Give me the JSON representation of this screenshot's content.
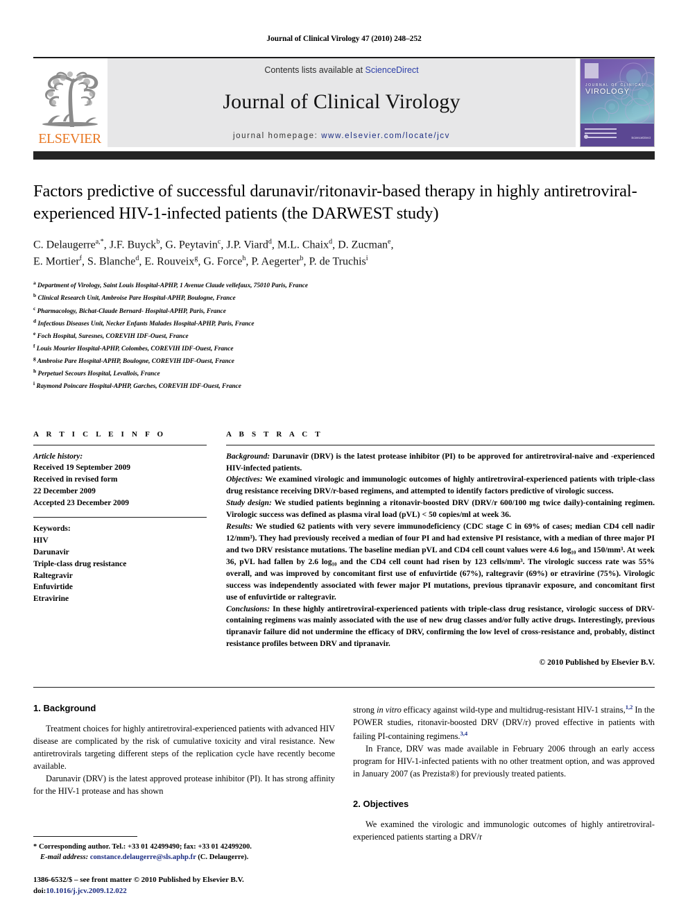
{
  "running_head": "Journal of Clinical Virology 47 (2010) 248–252",
  "masthead": {
    "publisher_name": "ELSEVIER",
    "contents_prefix": "Contents lists available at",
    "contents_link": "ScienceDirect",
    "journal_name": "Journal of Clinical Virology",
    "homepage_prefix": "journal homepage:",
    "homepage_url": "www.elsevier.com/locate/jcv",
    "cover": {
      "sub_title": "JOURNAL OF CLINICAL",
      "title": "VIROLOGY",
      "footer_brand": "ScienceDirect"
    },
    "colors": {
      "link_blue": "#2b3ea8",
      "url_navy": "#1c2d82",
      "elsevier_orange": "#E87722",
      "band_dark": "#232323",
      "masthead_grey": "#e7e7e8"
    }
  },
  "article": {
    "title": "Factors predictive of successful darunavir/ritonavir-based therapy in highly antiretroviral-experienced HIV-1-infected patients (the DARWEST study)",
    "authors_line_1": "C. Delaugerre<sup>a,*</sup>, J.F. Buyck<sup>b</sup>, G. Peytavin<sup>c</sup>, J.P. Viard<sup>d</sup>, M.L. Chaix<sup>d</sup>, D. Zucman<sup>e</sup>,",
    "authors_line_2": "E. Mortier<sup>f</sup>, S. Blanche<sup>d</sup>, E. Rouveix<sup>g</sup>, G. Force<sup>h</sup>, P. Aegerter<sup>b</sup>, P. de Truchis<sup>i</sup>",
    "affiliations": [
      {
        "mark": "a",
        "text": "Department of Virology, Saint Louis Hospital-APHP, 1 Avenue Claude vellefaux, 75010 Paris, France"
      },
      {
        "mark": "b",
        "text": "Clinical Research Unit, Ambroise Pare Hospital-APHP, Boulogne, France"
      },
      {
        "mark": "c",
        "text": "Pharmacology, Bichat-Claude Bernard- Hospital-APHP, Paris, France"
      },
      {
        "mark": "d",
        "text": "Infectious Diseases Unit, Necker Enfants Malades Hospital-APHP, Paris, France"
      },
      {
        "mark": "e",
        "text": "Foch Hospital, Suresnes, COREVIH IDF-Ouest, France"
      },
      {
        "mark": "f",
        "text": "Louis Mourier Hospital-APHP, Colombes, COREVIH IDF-Ouest, France"
      },
      {
        "mark": "g",
        "text": "Ambroise Pare Hospital-APHP, Boulogne, COREVIH IDF-Ouest, France"
      },
      {
        "mark": "h",
        "text": "Perpetuel Secours Hospital, Levallois, France"
      },
      {
        "mark": "i",
        "text": "Raymond Poincare Hospital-APHP, Garches, COREVIH IDF-Ouest, France"
      }
    ]
  },
  "article_info": {
    "heading": "A R T I C L E  I N F O",
    "history_label": "Article history:",
    "history": [
      "Received 19 September 2009",
      "Received in revised form",
      "22 December 2009",
      "Accepted 23 December 2009"
    ],
    "keywords_label": "Keywords:",
    "keywords": [
      "HIV",
      "Darunavir",
      "Triple-class drug resistance",
      "Raltegravir",
      "Enfuvirtide",
      "Etravirine"
    ]
  },
  "abstract": {
    "heading": "A B S T R A C T",
    "sections": [
      {
        "label": "Background:",
        "text": " Darunavir (DRV) is the latest protease inhibitor (PI) to be approved for antiretroviral-naive and -experienced HIV-infected patients."
      },
      {
        "label": "Objectives:",
        "text": " We examined virologic and immunologic outcomes of highly antiretroviral-experienced patients with triple-class drug resistance receiving DRV/r-based regimens, and attempted to identify factors predictive of virologic success."
      },
      {
        "label": "Study design:",
        "text": " We studied patients beginning a ritonavir-boosted DRV (DRV/r 600/100 mg twice daily)-containing regimen. Virologic success was defined as plasma viral load (pVL) < 50 copies/ml at week 36."
      },
      {
        "label": "Results:",
        "text": " We studied 62 patients with very severe immunodeficiency (CDC stage C in 69% of cases; median CD4 cell nadir 12/mm³). They had previously received a median of four PI and had extensive PI resistance, with a median of three major PI and two DRV resistance mutations. The baseline median pVL and CD4 cell count values were 4.6 log₁₀ and 150/mm³. At week 36, pVL had fallen by 2.6 log₁₀ and the CD4 cell count had risen by 123 cells/mm³. The virologic success rate was 55% overall, and was improved by concomitant first use of enfuvirtide (67%), raltegravir (69%) or etravirine (75%). Virologic success was independently associated with fewer major PI mutations, previous tipranavir exposure, and concomitant first use of enfuvirtide or raltegravir."
      },
      {
        "label": "Conclusions:",
        "text": " In these highly antiretroviral-experienced patients with triple-class drug resistance, virologic success of DRV-containing regimens was mainly associated with the use of new drug classes and/or fully active drugs. Interestingly, previous tipranavir failure did not undermine the efficacy of DRV, confirming the low level of cross-resistance and, probably, distinct resistance profiles between DRV and tipranavir."
      }
    ],
    "copyright": "© 2010 Published by Elsevier B.V."
  },
  "body": {
    "left": {
      "section1_heading": "1.  Background",
      "p1": "Treatment choices for highly antiretroviral-experienced patients with advanced HIV disease are complicated by the risk of cumulative toxicity and viral resistance. New antiretrovirals targeting different steps of the replication cycle have recently become available.",
      "p2": "Darunavir (DRV) is the latest approved protease inhibitor (PI). It has strong affinity for the HIV-1 protease and has shown"
    },
    "right": {
      "p1_pre": "strong ",
      "p1_italic": "in vitro",
      "p1_mid": " efficacy against wild-type and multidrug-resistant HIV-1 strains,",
      "p1_ref1": "1,2",
      "p1_mid2": " In the POWER studies, ritonavir-boosted DRV (DRV/r) proved effective in patients with failing PI-containing regimens.",
      "p1_ref2": "3,4",
      "p2": "In France, DRV was made available in February 2006 through an early access program for HIV-1-infected patients with no other treatment option, and was approved in January 2007 (as Prezista®) for previously treated patients.",
      "section2_heading": "2.  Objectives",
      "p3": "We examined the virologic and immunologic outcomes of highly antiretroviral-experienced patients starting a DRV/r"
    }
  },
  "footnote": {
    "corresponding": "* Corresponding author. Tel.: +33 01 42499490; fax: +33 01 42499200.",
    "email_label": "E-mail address:",
    "email": "constance.delaugerre@sls.aphp.fr",
    "email_suffix": " (C. Delaugerre).",
    "issn_line": "1386-6532/$ – see front matter © 2010 Published by Elsevier B.V.",
    "doi_label": "doi:",
    "doi": "10.1016/j.jcv.2009.12.022"
  }
}
